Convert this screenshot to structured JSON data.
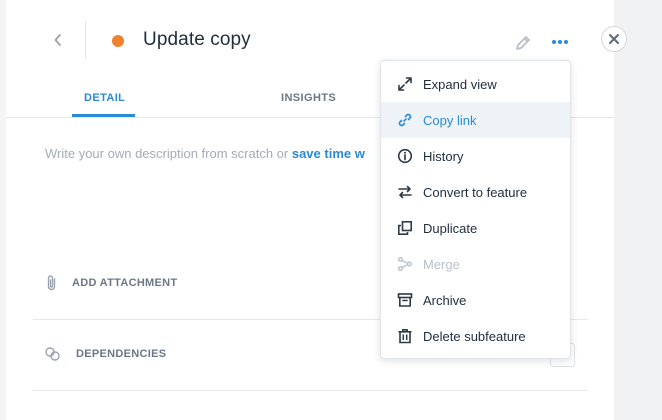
{
  "header": {
    "title": "Update copy",
    "status_color": "#F0812E"
  },
  "tabs": [
    {
      "label": "DETAIL",
      "active": true
    },
    {
      "label": "INSIGHTS",
      "active": false
    }
  ],
  "description": {
    "placeholder": "Write your own description from scratch or ",
    "link": "save time w"
  },
  "sections": {
    "attachment_label": "ADD ATTACHMENT",
    "dependencies_label": "DEPENDENCIES"
  },
  "menu": {
    "items": [
      {
        "label": "Expand view",
        "icon": "expand-icon",
        "state": "normal"
      },
      {
        "label": "Copy link",
        "icon": "link-icon",
        "state": "hover"
      },
      {
        "label": "History",
        "icon": "info-icon",
        "state": "normal"
      },
      {
        "label": "Convert to feature",
        "icon": "convert-arrows-icon",
        "state": "normal"
      },
      {
        "label": "Duplicate",
        "icon": "duplicate-icon",
        "state": "normal"
      },
      {
        "label": "Merge",
        "icon": "merge-icon",
        "state": "disabled"
      },
      {
        "label": "Archive",
        "icon": "archive-icon",
        "state": "normal"
      },
      {
        "label": "Delete subfeature",
        "icon": "trash-icon",
        "state": "normal"
      }
    ]
  },
  "colors": {
    "accent": "#2A8AD4",
    "status_orange": "#F0812E",
    "disabled_text": "#B9C1CA"
  }
}
